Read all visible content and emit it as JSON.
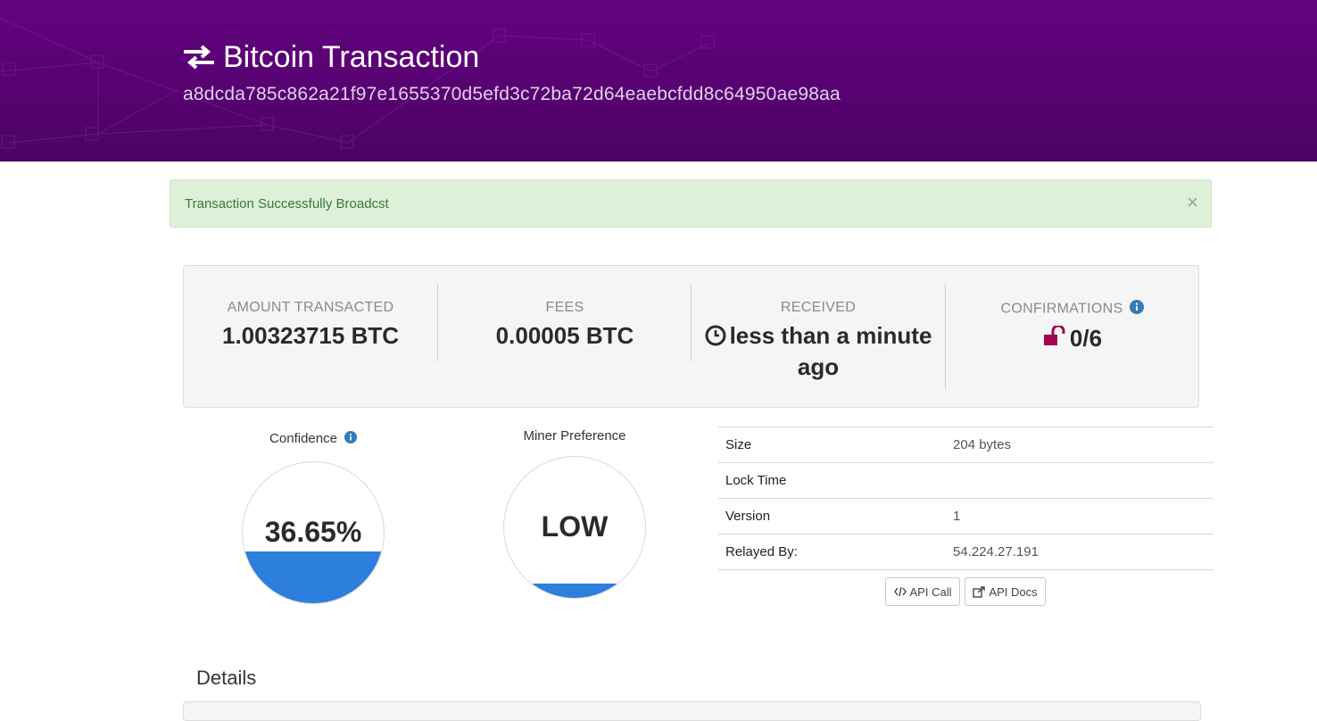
{
  "header": {
    "title": "Bitcoin Transaction",
    "hash": "a8dcda785c862a21f97e1655370d5efd3c72ba72d64eaebcfdd8c64950ae98aa",
    "icon": "exchange-icon"
  },
  "alert": {
    "message": "Transaction Successfully Broadcst",
    "close": "×"
  },
  "stats": {
    "amount": {
      "label": "AMOUNT TRANSACTED",
      "value": "1.00323715 BTC"
    },
    "fees": {
      "label": "FEES",
      "value": "0.00005 BTC"
    },
    "received": {
      "label": "RECEIVED",
      "value": "less than a minute ago",
      "icon": "clock-icon"
    },
    "confirmations": {
      "label": "CONFIRMATIONS",
      "value": "0/6",
      "icon": "unlock-icon"
    }
  },
  "confidence": {
    "title": "Confidence",
    "value": "36.65%",
    "fill_fraction": 0.3665
  },
  "miner_preference": {
    "title": "Miner Preference",
    "value": "LOW",
    "fill_fraction": 0.1
  },
  "properties": [
    {
      "key": "Size",
      "value": "204 bytes"
    },
    {
      "key": "Lock Time",
      "value": ""
    },
    {
      "key": "Version",
      "value": "1"
    },
    {
      "key": "Relayed By:",
      "value": "54.224.27.191"
    }
  ],
  "buttons": {
    "api_call": "API Call",
    "api_docs": "API Docs"
  },
  "details": {
    "title": "Details"
  },
  "colors": {
    "header": "#5c037a",
    "accent": "#2c7fdc",
    "confirm": "#a0074e",
    "alert_bg": "#dff0d8"
  }
}
